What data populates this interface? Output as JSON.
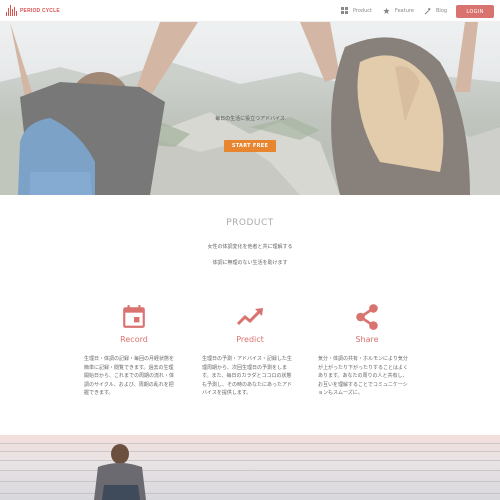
{
  "nav": {
    "logo_text": "PERIOD CYCLE",
    "items": [
      {
        "label": "Product",
        "icon": "grid-icon"
      },
      {
        "label": "Feature",
        "icon": "star-icon"
      },
      {
        "label": "Blog",
        "icon": "blog-icon"
      }
    ],
    "login_label": "LOGIN"
  },
  "hero": {
    "subtitle": "毎日の生活に役立つアドバイス",
    "cta_label": "START FREE"
  },
  "product": {
    "title": "PRODUCT",
    "lead1": "女性の体調変化を他者と共に理解する",
    "lead2": "体調に無理のない生活を助けます",
    "features": [
      {
        "title": "Record",
        "icon": "calendar-icon",
        "lines": [
          "生理日・体調の記録・毎回の月経状態を",
          "簡単に記録・閲覧できます。過去の生理",
          "開始日から、これまでの周期の流れ・体",
          "調のサイクル、および、周期の乱れを把",
          "握できます。"
        ]
      },
      {
        "title": "Predict",
        "icon": "trend-icon",
        "lines": [
          "生理日の予測・アドバイス・記録した生",
          "理周期から、次回生理日の予測をしま",
          "す。また、毎日のカラダとココロの状態",
          "も予測し、その時のあなたにあったアド",
          "バイスを提供します。"
        ]
      },
      {
        "title": "Share",
        "icon": "share-icon",
        "lines": [
          "気分・体調の共有・ホルモンにより気分",
          "が上がったり下がったりすることはよく",
          "あります。あなたの周りの人と共有し、",
          "お互いを理解することでコミュニケーシ",
          "ョンもスムーズに。"
        ]
      }
    ]
  },
  "colors": {
    "accent": "#d9736f",
    "cta": "#e8862f"
  }
}
